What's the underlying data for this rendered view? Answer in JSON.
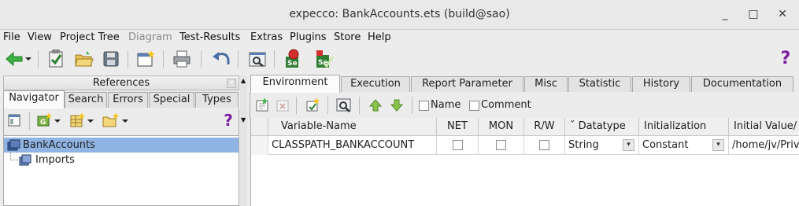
{
  "window": {
    "title": "expecco: BankAccounts.ets (build@sao)",
    "controls": {
      "minimize": "_",
      "maximize": "□",
      "close": "✕"
    }
  },
  "menubar": [
    {
      "label": "File",
      "enabled": true
    },
    {
      "label": "View",
      "enabled": true
    },
    {
      "label": "Project Tree",
      "enabled": true
    },
    {
      "label": "Diagram",
      "enabled": false
    },
    {
      "label": "Test-Results",
      "enabled": true
    },
    {
      "label": "Extras",
      "enabled": true
    },
    {
      "label": "Plugins",
      "enabled": true
    },
    {
      "label": "Store",
      "enabled": true
    },
    {
      "label": "Help",
      "enabled": true
    }
  ],
  "toolbar": {
    "icons": [
      "back-arrow-icon",
      "dropdown-arrow-icon",
      "checklist-icon",
      "open-folder-icon",
      "save-disk-icon",
      "new-window-icon",
      "printer-icon",
      "undo-icon",
      "search-window-icon",
      "selenium-record-icon",
      "selenium-run-icon",
      "help-icon"
    ],
    "help_glyph": "?"
  },
  "left_panel": {
    "header": "References",
    "close_glyph": "✕",
    "tabs": [
      "Navigator",
      "Search",
      "Errors",
      "Special",
      "Types"
    ],
    "active_tab": "Navigator",
    "help_glyph": "?",
    "tree": [
      {
        "label": "BankAccounts",
        "icon": "package-icon",
        "selected": true
      },
      {
        "label": "Imports",
        "icon": "imports-icon",
        "selected": false
      }
    ]
  },
  "splitter": {
    "up": "▲",
    "down": "▼"
  },
  "right_panel": {
    "tabs": [
      "Environment",
      "Execution",
      "Report Parameter",
      "Misc",
      "Statistic",
      "History",
      "Documentation"
    ],
    "active_tab": "Environment",
    "filters": [
      {
        "label": "Name",
        "checked": false
      },
      {
        "label": "Comment",
        "checked": false
      }
    ],
    "table": {
      "sort_glyph": "ˇ",
      "columns": [
        "Variable-Name",
        "NET",
        "MON",
        "R/W",
        "Datatype",
        "Initialization",
        "Initial Value/"
      ],
      "rows": [
        {
          "name": "CLASSPATH_BANKACCOUNT",
          "net": false,
          "mon": false,
          "rw": false,
          "datatype": "String",
          "initialization": "Constant",
          "initial_value": "/home/jv/Priv",
          "dropdown_glyph": "▾"
        }
      ]
    }
  },
  "colors": {
    "selection": "#8fb4e3",
    "green_arrow": "#3cb043",
    "help": "#7b1fa2",
    "selenium_red": "#d32f2f"
  }
}
